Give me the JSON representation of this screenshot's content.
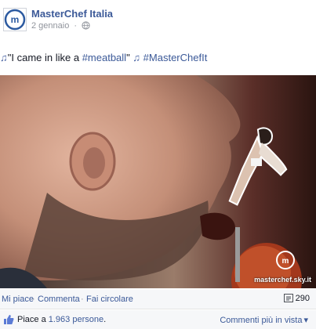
{
  "page": {
    "name": "MasterChef Italia",
    "date": "2 gennaio",
    "separator": "·"
  },
  "post": {
    "caption_text": "\"I came in like a ",
    "hashtag1": "#meatball",
    "caption_text2": "\" ",
    "hashtag2": "#MasterChefIt",
    "note1": "♫",
    "note2": "♫"
  },
  "photo": {
    "watermark": "masterchef.sky.it"
  },
  "actions": {
    "like_label": "Mi piace",
    "comment_label": "Commenta",
    "share_label": "Fai circolare",
    "dot": "·",
    "share_count": "290"
  },
  "likes": {
    "prefix": "Piace a ",
    "count": "1.963 persone",
    "suffix": ".",
    "relevant_label": "Commenti più in vista"
  },
  "colors": {
    "link": "#3b5998",
    "meta": "#90949c",
    "bar_bg": "#f6f7f9"
  }
}
